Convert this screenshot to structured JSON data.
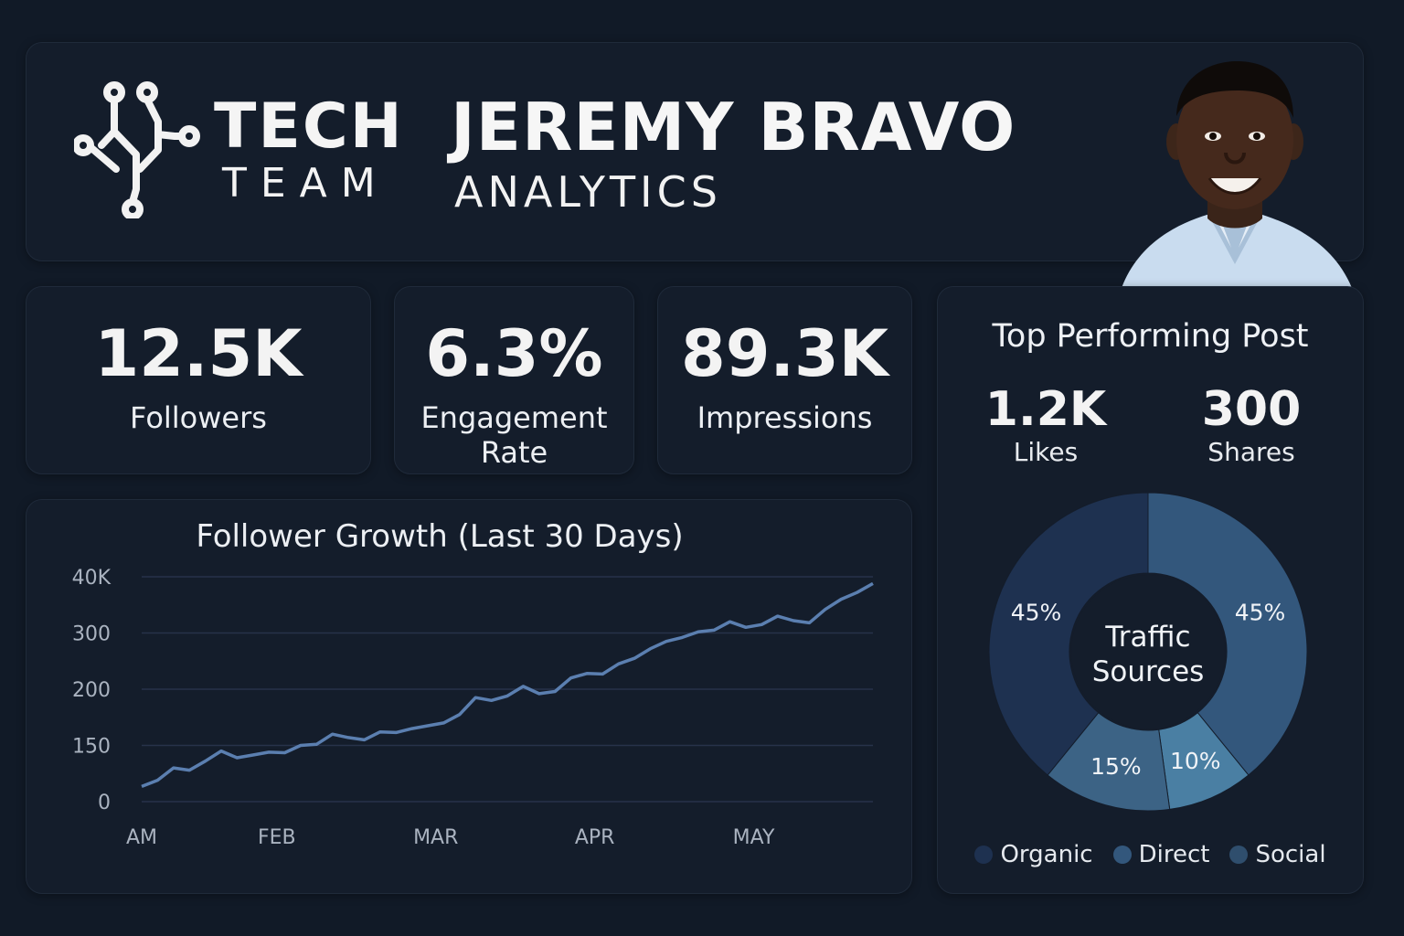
{
  "brand": {
    "logo_line1": "TECH",
    "logo_line2": "TEAM",
    "logo_icon": "circuit-tree-icon"
  },
  "header": {
    "name": "JEREMY BRAVO",
    "subtitle": "ANALYTICS",
    "avatar": "profile-photo"
  },
  "stats": {
    "followers": {
      "value": "12.5K",
      "label": "Followers"
    },
    "engagement": {
      "value": "6.3%",
      "label_line1": "Engagement",
      "label_line2": "Rate"
    },
    "impressions": {
      "value": "89.3K",
      "label": "Impressions"
    }
  },
  "top_post": {
    "title": "Top Performing Post",
    "likes_value": "1.2K",
    "likes_label": "Likes",
    "shares_value": "300",
    "shares_label": "Shares"
  },
  "colors": {
    "background": "#111a27",
    "card": "#141d2b",
    "line": "#5b7fb0",
    "organic": "#1e3150",
    "direct": "#33577c",
    "social": "#2f4e6d",
    "segment_15": "#3c6385",
    "segment_10": "#4a7fa3"
  },
  "chart_data": [
    {
      "type": "line",
      "title": "Follower Growth (Last 30 Days)",
      "xlabel": "",
      "ylabel": "",
      "y_tick_labels": [
        "0",
        "150",
        "200",
        "300",
        "40K"
      ],
      "x_tick_labels": [
        "AM",
        "FEB",
        "MAR",
        "APR",
        "MAY"
      ],
      "x_tick_positions": [
        0,
        8.5,
        18.5,
        28.5,
        38.5
      ],
      "grid": true,
      "note_scale": "tick index scale (0-4)",
      "x": [
        0,
        1,
        2,
        3,
        4,
        5,
        6,
        7,
        8,
        9,
        10,
        11,
        12,
        13,
        14,
        15,
        16,
        17,
        18,
        19,
        20,
        21,
        22,
        23,
        24,
        25,
        26,
        27,
        28,
        29,
        30,
        31,
        32,
        33,
        34,
        35,
        36,
        37,
        38,
        39,
        40,
        41,
        42,
        43,
        44,
        45,
        46
      ],
      "series": [
        {
          "values": [
            0.27,
            0.38,
            0.6,
            0.56,
            0.72,
            0.9,
            0.78,
            0.83,
            0.88,
            0.87,
            1.0,
            1.02,
            1.2,
            1.14,
            1.1,
            1.24,
            1.23,
            1.3,
            1.35,
            1.4,
            1.55,
            1.85,
            1.8,
            1.88,
            2.05,
            1.92,
            1.96,
            2.2,
            2.28,
            2.27,
            2.45,
            2.55,
            2.72,
            2.85,
            2.92,
            3.02,
            3.05,
            3.2,
            3.1,
            3.15,
            3.3,
            3.22,
            3.18,
            3.42,
            3.6,
            3.72,
            3.88
          ]
        }
      ]
    },
    {
      "type": "pie",
      "title": "Traffic Sources",
      "categories": [
        "Organic",
        "Direct",
        "Social"
      ],
      "segment_labels": [
        "45%",
        "45%",
        "10%",
        "15%"
      ],
      "values": [
        45,
        45,
        10,
        15
      ],
      "legend": "bottom"
    }
  ]
}
